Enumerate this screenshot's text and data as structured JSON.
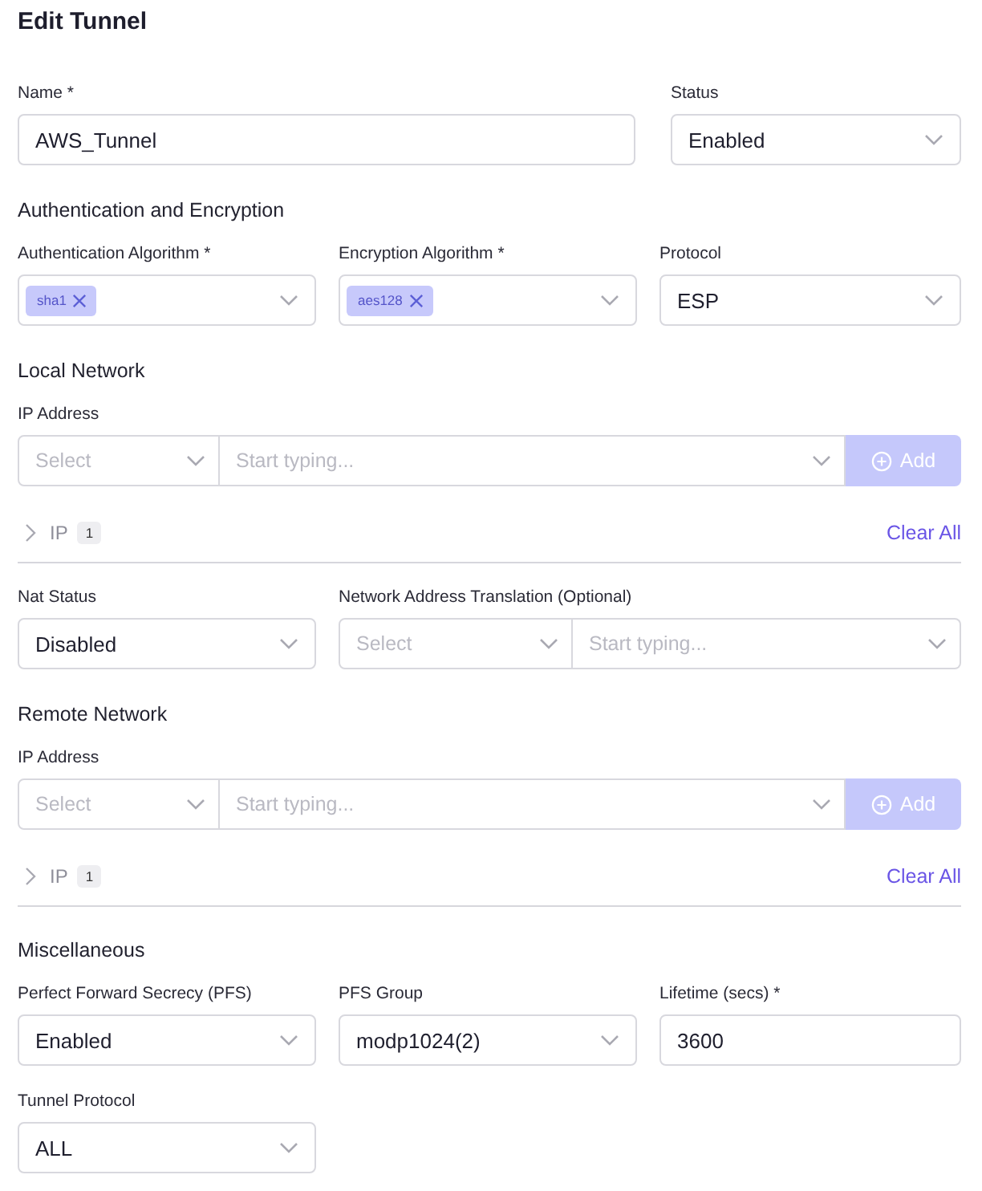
{
  "title": "Edit Tunnel",
  "blocks": [
    {
      "kind": "name_row",
      "fields": [
        {
          "kind": "text",
          "label": "Name *",
          "value": "AWS_Tunnel"
        },
        {
          "kind": "select",
          "label": "Status",
          "value": "Enabled"
        }
      ]
    },
    {
      "kind": "heading",
      "text": "Authentication and Encryption"
    },
    {
      "kind": "row",
      "fields": [
        {
          "kind": "tags",
          "label": "Authentication Algorithm *",
          "tags": [
            "sha1"
          ]
        },
        {
          "kind": "tags",
          "label": "Encryption Algorithm *",
          "tags": [
            "aes128"
          ]
        },
        {
          "kind": "select",
          "label": "Protocol",
          "value": "ESP"
        }
      ]
    },
    {
      "kind": "heading",
      "text": "Local Network"
    },
    {
      "kind": "ip_input",
      "label": "IP Address",
      "select_placeholder": "Select",
      "input_placeholder": "Start typing...",
      "button": "Add",
      "disabled": true
    },
    {
      "kind": "ip_list",
      "label": "IP",
      "count": "1",
      "expanded": false,
      "action": "Clear All"
    },
    {
      "kind": "row",
      "fields": [
        {
          "kind": "select",
          "label": "Nat Status",
          "value": "Disabled"
        },
        {
          "kind": "split",
          "label": "Network Address Translation (Optional)",
          "select_placeholder": "Select",
          "input_placeholder": "Start typing..."
        }
      ]
    },
    {
      "kind": "heading",
      "text": "Remote Network"
    },
    {
      "kind": "ip_input",
      "label": "IP Address",
      "select_placeholder": "Select",
      "input_placeholder": "Start typing...",
      "button": "Add",
      "disabled": true
    },
    {
      "kind": "ip_list",
      "label": "IP",
      "count": "1",
      "expanded": false,
      "action": "Clear All"
    },
    {
      "kind": "heading",
      "text": "Miscellaneous"
    },
    {
      "kind": "row",
      "fields": [
        {
          "kind": "select",
          "label": "Perfect Forward Secrecy (PFS)",
          "value": "Enabled"
        },
        {
          "kind": "select",
          "label": "PFS Group",
          "value": "modp1024(2)"
        },
        {
          "kind": "text",
          "label": "Lifetime (secs) *",
          "value": "3600"
        }
      ]
    },
    {
      "kind": "row",
      "fields": [
        {
          "kind": "select",
          "label": "Tunnel Protocol",
          "value": "ALL"
        }
      ]
    }
  ]
}
